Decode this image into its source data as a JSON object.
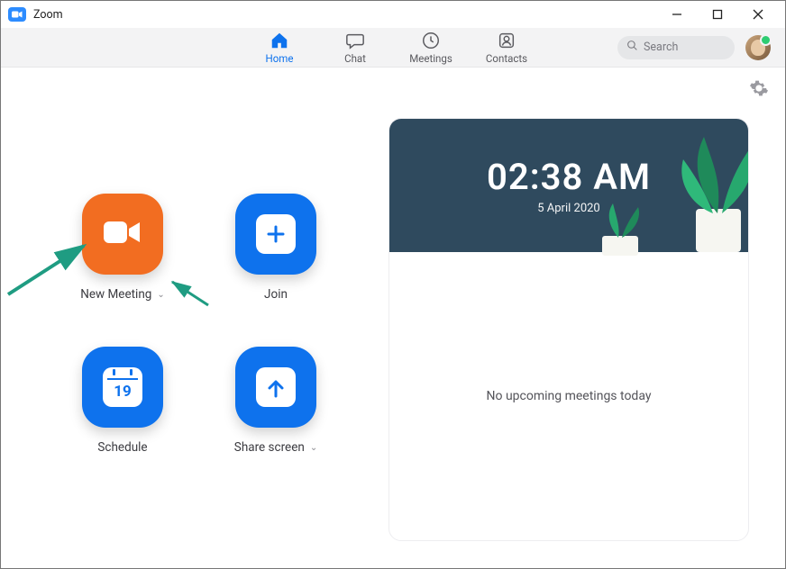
{
  "window": {
    "title": "Zoom"
  },
  "tabs": {
    "home": "Home",
    "chat": "Chat",
    "meetings": "Meetings",
    "contacts": "Contacts"
  },
  "search": {
    "placeholder": "Search"
  },
  "actions": {
    "new_meeting": "New Meeting",
    "join": "Join",
    "schedule": "Schedule",
    "schedule_day": "19",
    "share_screen": "Share screen"
  },
  "clock": {
    "time": "02:38 AM",
    "date": "5 April 2020"
  },
  "status": {
    "no_meetings": "No upcoming meetings today"
  },
  "colors": {
    "accent_blue": "#0E72ED",
    "accent_orange": "#F26D21",
    "hero_bg": "#2f4a5e",
    "plant_green": "#2aa06b",
    "annotation": "#1f9c82"
  }
}
